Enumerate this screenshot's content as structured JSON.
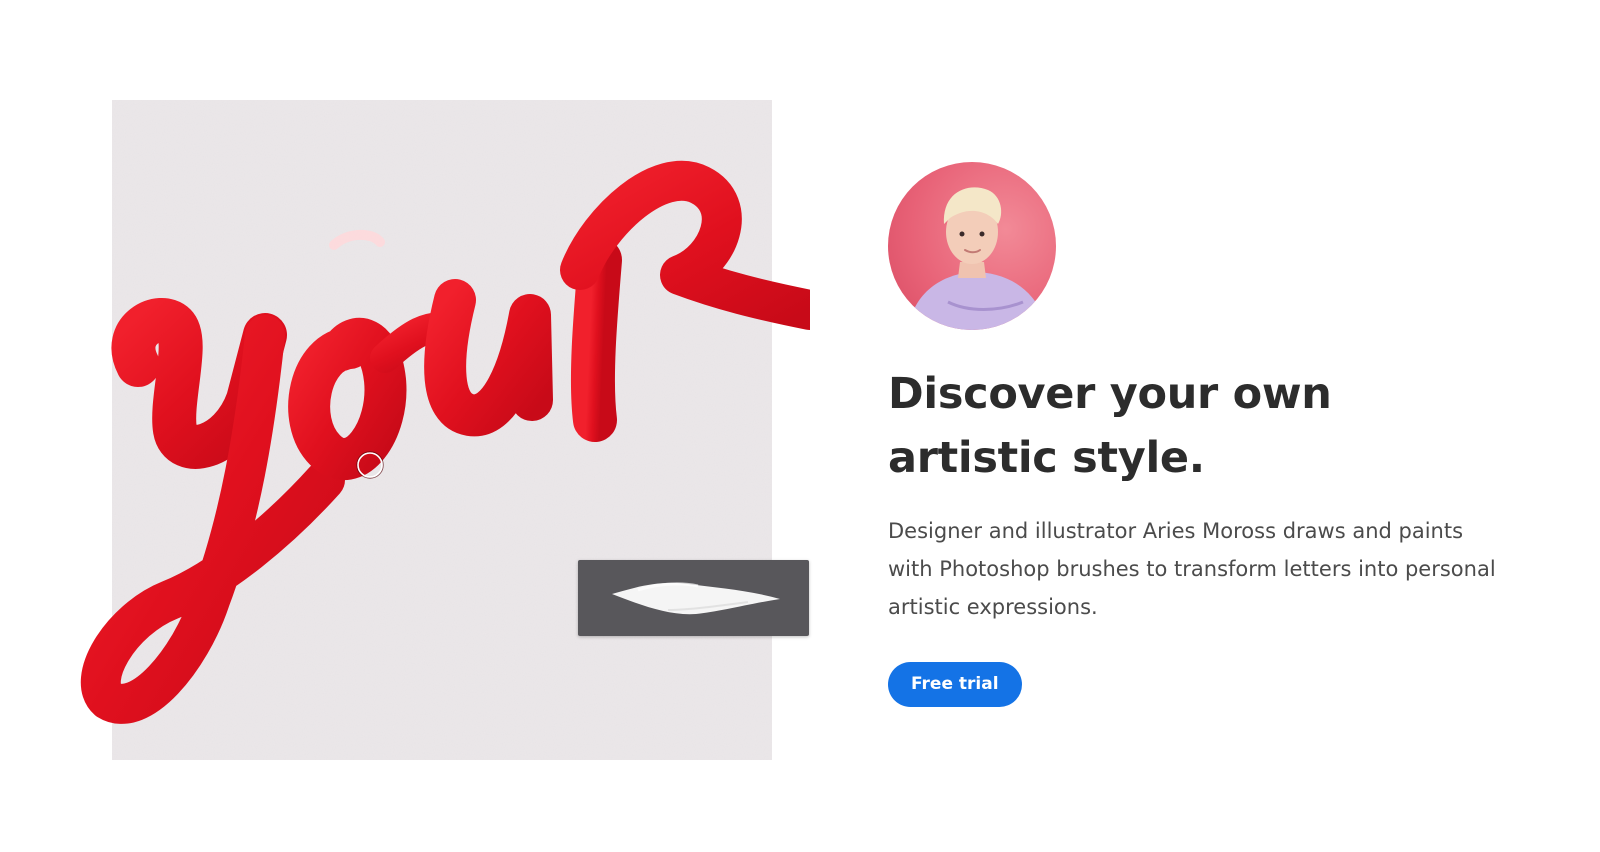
{
  "hero": {
    "headline": "Discover your own artistic style.",
    "description": "Designer and illustrator Aries Moross draws and paints with Photoshop brushes to transform letters into personal artistic expressions.",
    "cta_label": "Free trial"
  },
  "artwork": {
    "lettering": "your",
    "ink_color": "#e0101e",
    "paper_color": "#ece8ea"
  },
  "brush_panel": {
    "background": "#58575b"
  },
  "colors": {
    "accent": "#1473e6",
    "headline": "#2c2c2c",
    "body_text": "#4b4b4b"
  }
}
